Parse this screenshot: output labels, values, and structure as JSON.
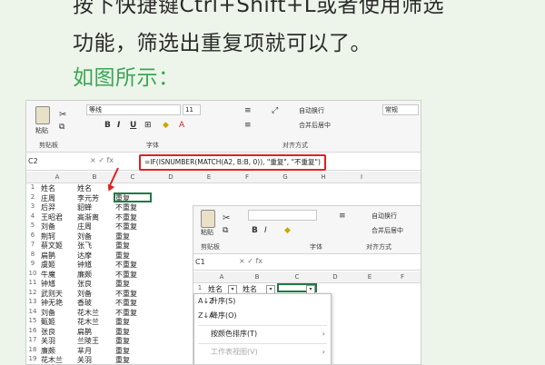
{
  "article": {
    "line1": "按下快捷键Ctrl+Shift+L或者使用筛选",
    "line2": "功能，筛选出重复项就可以了。",
    "line3": "如图所示："
  },
  "sheet1": {
    "ribbon": {
      "paste": "粘贴",
      "clipboard_label": "剪贴板",
      "font_name": "等线",
      "font_size": "11",
      "font_label": "字体",
      "align_label": "对齐方式",
      "wrap": "自动换行",
      "merge": "合并后居中",
      "number_format": "常规",
      "bold": "B",
      "italic": "I",
      "underline": "U"
    },
    "namebox": "C2",
    "formula_icons": "× ✓ fx",
    "formula": "=IF(ISNUMBER(MATCH(A2, B:B, 0)), \"重复\", \"不重复\")",
    "columns": [
      "A",
      "B",
      "C",
      "D",
      "E",
      "F",
      "G",
      "H",
      "I"
    ],
    "rows": [
      {
        "n": "1",
        "a": "姓名",
        "b": "姓名",
        "c": ""
      },
      {
        "n": "2",
        "a": "庄周",
        "b": "李元芳",
        "c": "重复"
      },
      {
        "n": "3",
        "a": "后羿",
        "b": "貂蝉",
        "c": "不重复"
      },
      {
        "n": "4",
        "a": "王昭君",
        "b": "高渐离",
        "c": "不重复"
      },
      {
        "n": "5",
        "a": "刘备",
        "b": "庄周",
        "c": "不重复"
      },
      {
        "n": "6",
        "a": "荆轲",
        "b": "刘备",
        "c": "重复"
      },
      {
        "n": "7",
        "a": "蔡文姬",
        "b": "张飞",
        "c": "重复"
      },
      {
        "n": "8",
        "a": "扁鹊",
        "b": "达摩",
        "c": "重复"
      },
      {
        "n": "9",
        "a": "虞姬",
        "b": "钟馗",
        "c": "不重复"
      },
      {
        "n": "10",
        "a": "牛魔",
        "b": "廉颇",
        "c": "不重复"
      },
      {
        "n": "11",
        "a": "钟馗",
        "b": "张良",
        "c": "重复"
      },
      {
        "n": "12",
        "a": "武则天",
        "b": "刘备",
        "c": "不重复"
      },
      {
        "n": "13",
        "a": "钟无艳",
        "b": "香玻",
        "c": "不重复"
      },
      {
        "n": "14",
        "a": "刘备",
        "b": "花木兰",
        "c": "不重复"
      },
      {
        "n": "15",
        "a": "甄姬",
        "b": "花木兰",
        "c": "重复"
      },
      {
        "n": "16",
        "a": "张良",
        "b": "扁鹊",
        "c": "重复"
      },
      {
        "n": "17",
        "a": "关羽",
        "b": "兰陵王",
        "c": "重复"
      },
      {
        "n": "18",
        "a": "廉颇",
        "b": "芈月",
        "c": "重复"
      },
      {
        "n": "19",
        "a": "花木兰",
        "b": "关羽",
        "c": "重复"
      }
    ]
  },
  "sheet2": {
    "ribbon": {
      "paste": "粘贴",
      "clipboard_label": "剪贴板",
      "font_label": "字体",
      "align_label": "对齐方式",
      "wrap": "自动换行",
      "merge": "合并后居中"
    },
    "namebox": "C1",
    "formula_icons": "× ✓ fx",
    "columns": [
      "A",
      "B",
      "C",
      "D",
      "E",
      "F"
    ],
    "header_row": {
      "n": "1",
      "a": "姓名",
      "b": "姓名"
    },
    "filter_menu": [
      {
        "icon": "A↓Z",
        "label": "升序(S)",
        "arrow": ""
      },
      {
        "icon": "Z↓A",
        "label": "降序(O)",
        "arrow": ""
      },
      {
        "icon": "",
        "label": "按颜色排序(T)",
        "arrow": "›"
      },
      {
        "icon": "",
        "label": "工作表视图(V)",
        "arrow": "›"
      }
    ]
  }
}
